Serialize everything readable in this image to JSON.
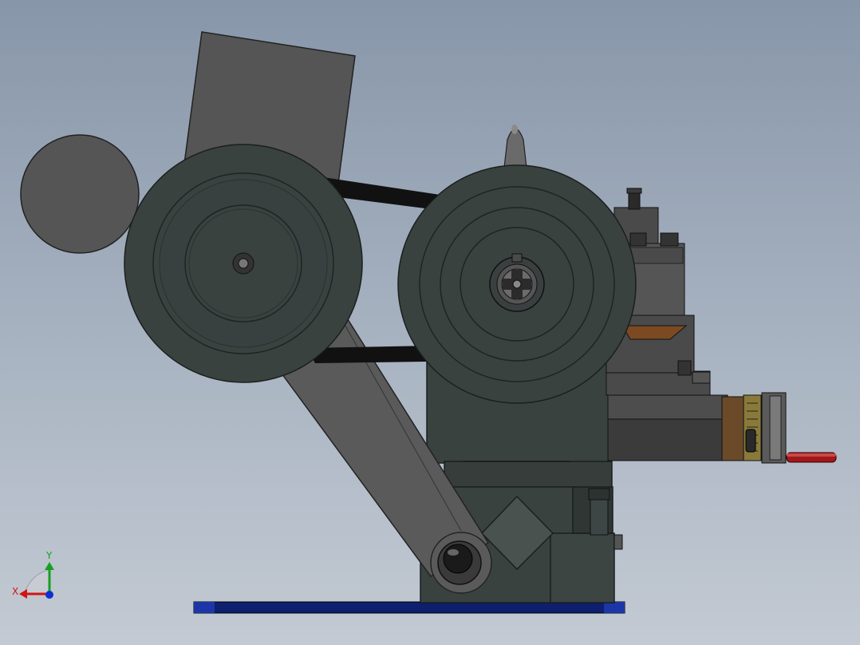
{
  "viewport": {
    "background_top": "#8796a9",
    "background_bottom": "#c3cad3"
  },
  "model": {
    "body_color": "#3a4240",
    "belt_color": "#111111",
    "arm_color": "#5a5a5a",
    "base_plate_color": "#0d1f6e",
    "handle_color": "#a01818",
    "dial_color": "#8a7a3a"
  },
  "triad": {
    "x_label": "X",
    "y_label": "Y",
    "x_color": "#d01515",
    "y_color": "#15a020",
    "z_color": "#1030d0"
  }
}
